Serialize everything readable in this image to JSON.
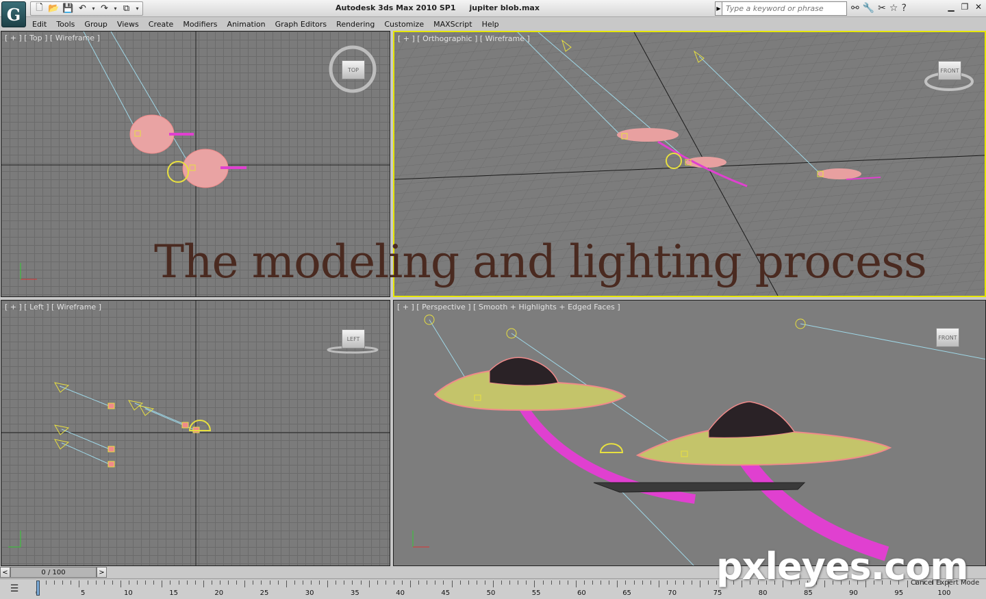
{
  "app": {
    "logo": "G",
    "title": "Autodesk 3ds Max  2010 SP1",
    "file": "jupiter blob.max"
  },
  "quick_access": {
    "icons": [
      "new-file-icon",
      "open-folder-icon",
      "save-icon",
      "undo-icon",
      "redo-icon",
      "project-folder-icon"
    ]
  },
  "search": {
    "placeholder": "Type a keyword or phrase"
  },
  "menu": {
    "items": [
      "Edit",
      "Tools",
      "Group",
      "Views",
      "Create",
      "Modifiers",
      "Animation",
      "Graph Editors",
      "Rendering",
      "Customize",
      "MAXScript",
      "Help"
    ]
  },
  "viewports": {
    "top": {
      "label": "[ + ] [ Top ] [ Wireframe ]",
      "cube": "TOP"
    },
    "ortho": {
      "label": "[ + ] [ Orthographic ] [ Wireframe ]",
      "cube": "FRONT"
    },
    "left": {
      "label": "[ + ] [ Left ] [ Wireframe ]",
      "cube": "LEFT"
    },
    "persp": {
      "label": "[ + ] [ Perspective ] [ Smooth + Highlights + Edged Faces ]",
      "cube": "FRONT"
    }
  },
  "overlay": {
    "caption": "The modeling and lighting process",
    "watermark": "pxleyes.com"
  },
  "timeslider": {
    "prev": "<",
    "position": "0 / 100",
    "next": ">",
    "progress": 0
  },
  "trackbar": {
    "ticks": [
      "0",
      "5",
      "10",
      "15",
      "20",
      "25",
      "30",
      "35",
      "40",
      "45",
      "50",
      "55",
      "60",
      "65",
      "70",
      "75",
      "80",
      "85",
      "90",
      "95",
      "100"
    ],
    "expert_label": "Cancel Expert Mode"
  },
  "colors": {
    "active_viewport": "#e6e600",
    "mesh": "#f08a8a",
    "stem": "#e040d0",
    "light": "#e8e040",
    "light_line": "#9fd8e8"
  }
}
